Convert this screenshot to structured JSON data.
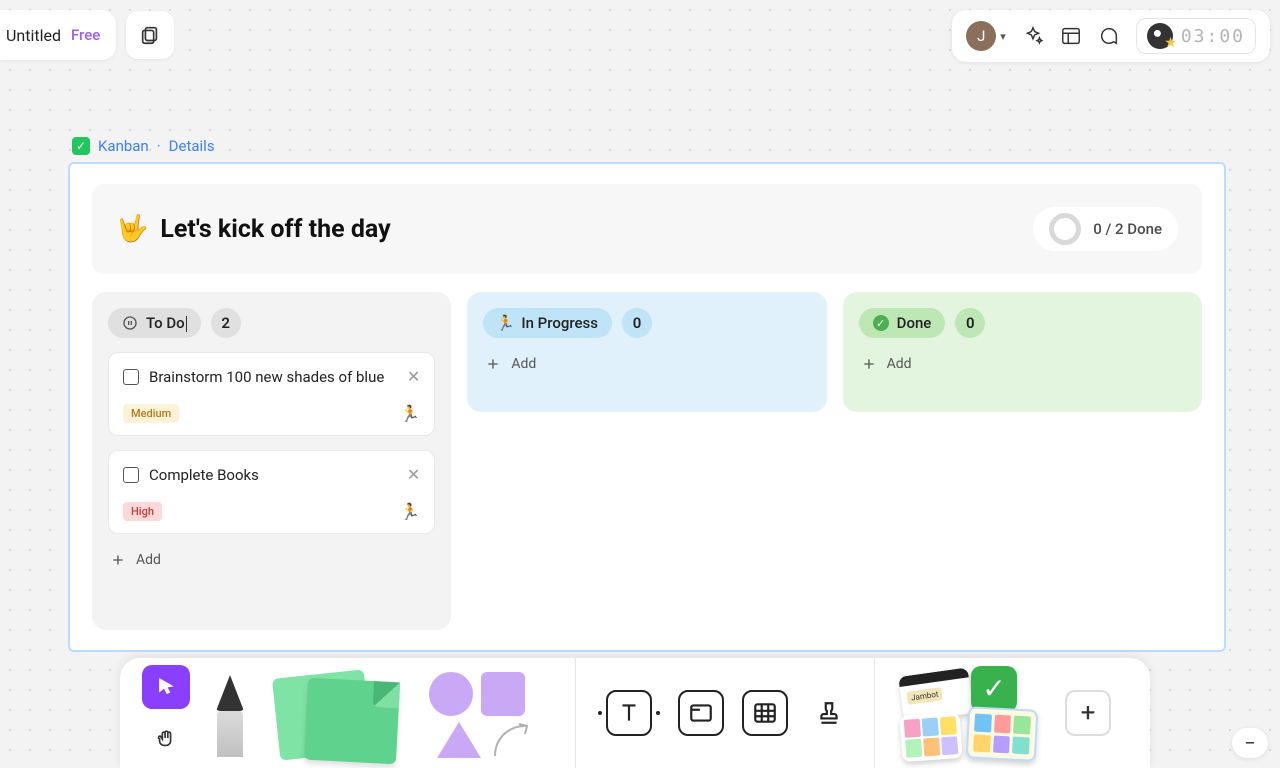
{
  "file": {
    "title": "Untitled",
    "plan": "Free"
  },
  "topbar": {
    "avatar_initial": "J",
    "timer": "03:00"
  },
  "crumb": {
    "view": "Kanban",
    "subview": "Details"
  },
  "board": {
    "emoji": "🤟",
    "title": "Let's kick off the day",
    "done_summary": "0 / 2 Done"
  },
  "columns": [
    {
      "key": "todo",
      "label": "To Do",
      "count": "2",
      "add": "Add",
      "cards": [
        {
          "title": "Brainstorm 100 new shades of blue",
          "priority": "Medium",
          "priority_key": "medium"
        },
        {
          "title": "Complete Books",
          "priority": "High",
          "priority_key": "high"
        }
      ]
    },
    {
      "key": "progress",
      "label": "In Progress",
      "count": "0",
      "add": "Add",
      "cards": []
    },
    {
      "key": "done",
      "label": "Done",
      "count": "0",
      "add": "Add",
      "cards": []
    }
  ],
  "widgets": {
    "jambot": "Jambot"
  },
  "palette_colors": [
    "#f7a1c4",
    "#9ad0f5",
    "#ffe066",
    "#b2f2bb",
    "#ffc078",
    "#d0bfff"
  ],
  "miniboard_colors": [
    "#6fc3f7",
    "#ff9b9b",
    "#97e69a",
    "#ffd56b",
    "#b79cff",
    "#7fe0d0"
  ]
}
